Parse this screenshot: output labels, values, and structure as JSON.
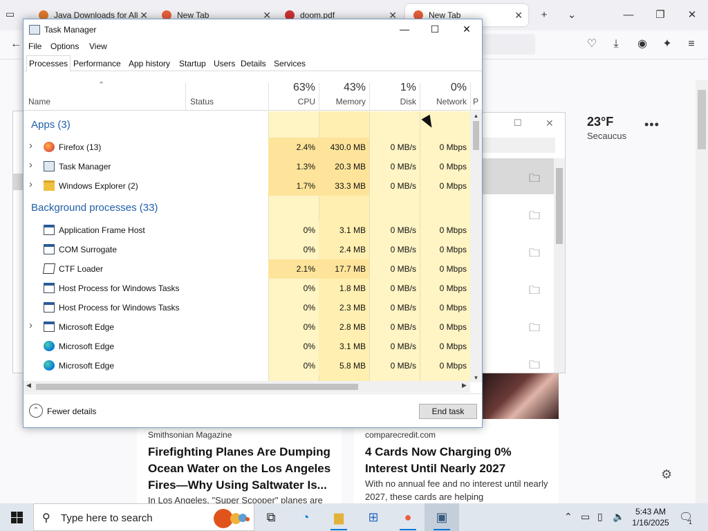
{
  "browser": {
    "tabs": [
      {
        "label": "Java Downloads for All",
        "close": "✕"
      },
      {
        "label": "New Tab",
        "close": "✕"
      },
      {
        "label": "doom.pdf",
        "close": "✕"
      },
      {
        "label": "New Tab",
        "close": "✕"
      }
    ],
    "new_tab": "+",
    "tab_list": "⌄",
    "minimize": "—",
    "restore": "❐",
    "close": "✕"
  },
  "weather": {
    "temp": "23°F",
    "city": "Secaucus",
    "more": "•••"
  },
  "news": [
    {
      "source": "Smithsonian Magazine",
      "headline": "Firefighting Planes Are Dumping Ocean Water on the Los Angeles Fires—Why Using Saltwater Is...",
      "snippet": "In Los Angeles, \"Super Scooper\" planes are"
    },
    {
      "source": "comparecredit.com",
      "headline": "4 Cards Now Charging 0% Interest Until Nearly 2027",
      "snippet": "With no annual fee and no interest until nearly 2027, these cards are helping"
    }
  ],
  "taskmgr": {
    "title": "Task Manager",
    "minimize": "—",
    "maximize": "☐",
    "close": "✕",
    "menu": [
      "File",
      "Options",
      "View"
    ],
    "tabs": [
      "Processes",
      "Performance",
      "App history",
      "Startup",
      "Users",
      "Details",
      "Services"
    ],
    "columns": {
      "name": "Name",
      "status": "Status",
      "cpu": {
        "pct": "63%",
        "label": "CPU"
      },
      "memory": {
        "pct": "43%",
        "label": "Memory"
      },
      "disk": {
        "pct": "1%",
        "label": "Disk"
      },
      "network": {
        "pct": "0%",
        "label": "Network"
      },
      "power": "P"
    },
    "groups": {
      "apps": "Apps (3)",
      "background": "Background processes (33)"
    },
    "apps": [
      {
        "name": "Firefox (13)",
        "cpu": "2.4%",
        "memory": "430.0 MB",
        "disk": "0 MB/s",
        "network": "0 Mbps",
        "icon": "firefox-icon"
      },
      {
        "name": "Task Manager",
        "cpu": "1.3%",
        "memory": "20.3 MB",
        "disk": "0 MB/s",
        "network": "0 Mbps",
        "icon": "task-manager-icon"
      },
      {
        "name": "Windows Explorer (2)",
        "cpu": "1.7%",
        "memory": "33.3 MB",
        "disk": "0 MB/s",
        "network": "0 Mbps",
        "icon": "folder-icon"
      }
    ],
    "background": [
      {
        "name": "Application Frame Host",
        "cpu": "0%",
        "memory": "3.1 MB",
        "disk": "0 MB/s",
        "network": "0 Mbps",
        "icon": "app-window-icon"
      },
      {
        "name": "COM Surrogate",
        "cpu": "0%",
        "memory": "2.4 MB",
        "disk": "0 MB/s",
        "network": "0 Mbps",
        "icon": "app-window-icon"
      },
      {
        "name": "CTF Loader",
        "cpu": "2.1%",
        "memory": "17.7 MB",
        "disk": "0 MB/s",
        "network": "0 Mbps",
        "icon": "ctf-loader-icon"
      },
      {
        "name": "Host Process for Windows Tasks",
        "cpu": "0%",
        "memory": "1.8 MB",
        "disk": "0 MB/s",
        "network": "0 Mbps",
        "icon": "app-window-icon"
      },
      {
        "name": "Host Process for Windows Tasks",
        "cpu": "0%",
        "memory": "2.3 MB",
        "disk": "0 MB/s",
        "network": "0 Mbps",
        "icon": "app-window-icon"
      },
      {
        "name": "Microsoft Edge",
        "cpu": "0%",
        "memory": "2.8 MB",
        "disk": "0 MB/s",
        "network": "0 Mbps",
        "icon": "app-window-icon"
      },
      {
        "name": "Microsoft Edge",
        "cpu": "0%",
        "memory": "3.1 MB",
        "disk": "0 MB/s",
        "network": "0 Mbps",
        "icon": "edge-icon"
      },
      {
        "name": "Microsoft Edge",
        "cpu": "0%",
        "memory": "5.8 MB",
        "disk": "0 MB/s",
        "network": "0 Mbps",
        "icon": "edge-icon"
      }
    ],
    "fewer_details": "Fewer details",
    "end_task": "End task"
  },
  "taskbar": {
    "search_placeholder": "Type here to search",
    "time": "5:43 AM",
    "date": "1/16/2025",
    "notification_count": "1"
  },
  "colors": {
    "accent": "#0078d4",
    "group_text": "#1f5fa8",
    "heat_light": "#fff4c4",
    "heat_mid": "#ffefb0",
    "heat_strong": "#fde49a"
  }
}
